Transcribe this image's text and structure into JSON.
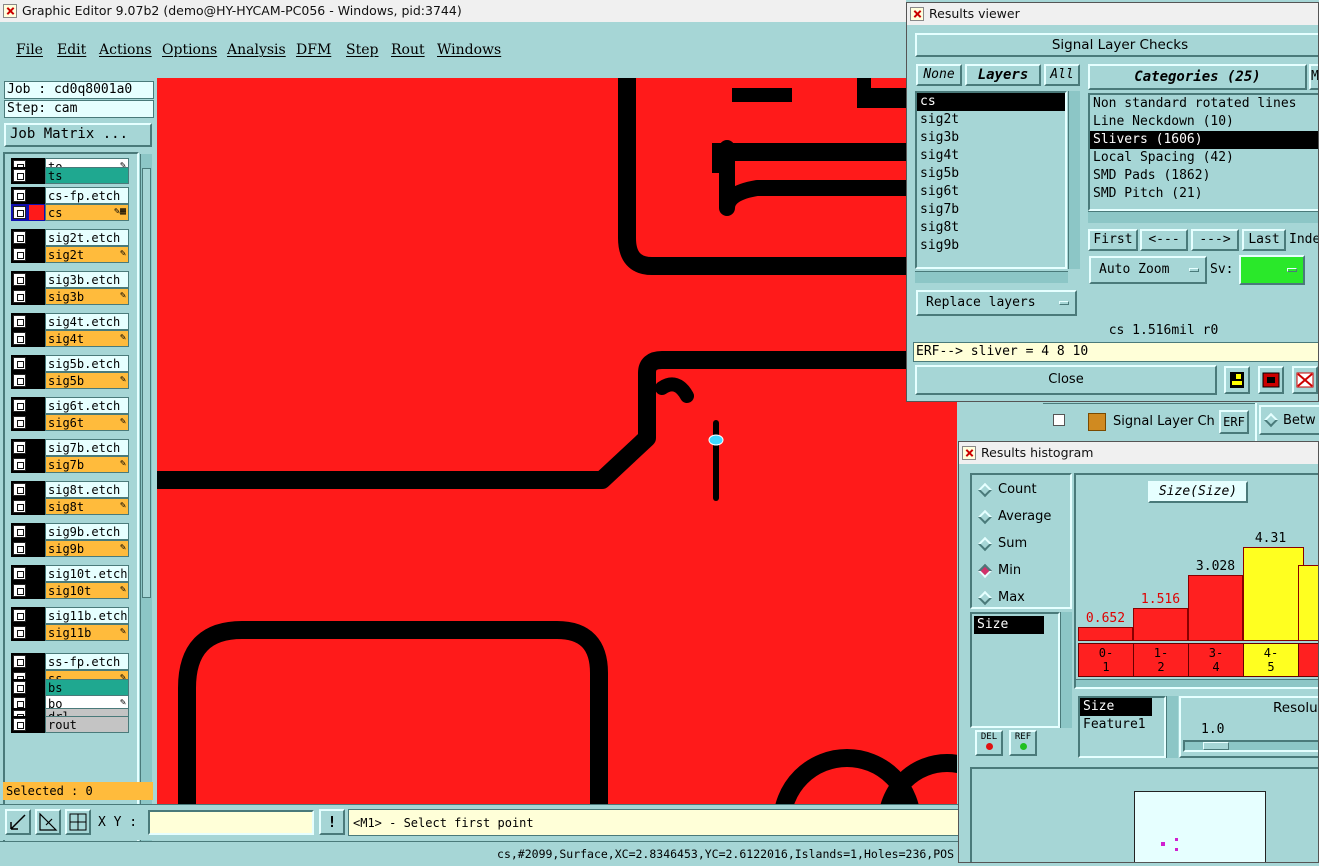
{
  "app": {
    "title": "Graphic Editor 9.07b2 (demo@HY-HYCAM-PC056 - Windows, pid:3744)"
  },
  "menu": [
    "File",
    "Edit",
    "Actions",
    "Options",
    "Analysis",
    "DFM",
    "Step",
    "Rout",
    "Windows"
  ],
  "left_panel": {
    "job": "Job : cd0q8001a0",
    "step": "Step: cam",
    "job_matrix": "Job Matrix ...",
    "selected": "Selected : 0",
    "layers": [
      {
        "name": "to",
        "color": "white",
        "icon": "edit"
      },
      {
        "name": "ts",
        "color": "green",
        "icon": ""
      },
      {
        "name": "cs-fp.etch",
        "color": "light",
        "icon": ""
      },
      {
        "name": "cs",
        "color": "orange",
        "icon": "edit-work",
        "active": true
      },
      {
        "name": "sig2t.etch",
        "color": "light",
        "icon": ""
      },
      {
        "name": "sig2t",
        "color": "orange",
        "icon": "edit"
      },
      {
        "name": "sig3b.etch",
        "color": "light",
        "icon": ""
      },
      {
        "name": "sig3b",
        "color": "orange",
        "icon": "edit"
      },
      {
        "name": "sig4t.etch",
        "color": "light",
        "icon": ""
      },
      {
        "name": "sig4t",
        "color": "orange",
        "icon": "edit"
      },
      {
        "name": "sig5b.etch",
        "color": "light",
        "icon": ""
      },
      {
        "name": "sig5b",
        "color": "orange",
        "icon": "edit"
      },
      {
        "name": "sig6t.etch",
        "color": "light",
        "icon": ""
      },
      {
        "name": "sig6t",
        "color": "orange",
        "icon": "edit"
      },
      {
        "name": "sig7b.etch",
        "color": "light",
        "icon": ""
      },
      {
        "name": "sig7b",
        "color": "orange",
        "icon": "edit"
      },
      {
        "name": "sig8t.etch",
        "color": "light",
        "icon": ""
      },
      {
        "name": "sig8t",
        "color": "orange",
        "icon": "edit"
      },
      {
        "name": "sig9b.etch",
        "color": "light",
        "icon": ""
      },
      {
        "name": "sig9b",
        "color": "orange",
        "icon": "edit"
      },
      {
        "name": "sig10t.etch",
        "color": "light",
        "icon": ""
      },
      {
        "name": "sig10t",
        "color": "orange",
        "icon": "edit"
      },
      {
        "name": "sig11b.etch",
        "color": "light",
        "icon": ""
      },
      {
        "name": "sig11b",
        "color": "orange",
        "icon": "edit"
      },
      {
        "name": "ss-fp.etch",
        "color": "light",
        "icon": ""
      },
      {
        "name": "ss",
        "color": "orange",
        "icon": "edit"
      },
      {
        "name": "bs",
        "color": "green",
        "icon": ""
      },
      {
        "name": "bo",
        "color": "white",
        "icon": "edit"
      },
      {
        "name": "drl",
        "color": "grey",
        "icon": ""
      },
      {
        "name": "rout",
        "color": "grey",
        "icon": ""
      }
    ]
  },
  "bottom_bar": {
    "xy_label": "X Y :",
    "xy_value": "",
    "prompt": "<M1> - Select first point",
    "status": "cs,#2099,Surface,XC=2.8346453,YC=2.6122016,Islands=1,Holes=236,POS"
  },
  "results_viewer": {
    "title": "Results viewer",
    "header": "Signal Layer Checks",
    "none_btn": "None",
    "layers_btn": "Layers",
    "all_btn": "All",
    "layers": [
      "cs",
      "sig2t",
      "sig3b",
      "sig4t",
      "sig5b",
      "sig6t",
      "sig7b",
      "sig8t",
      "sig9b"
    ],
    "categories_btn": "Categories (25)",
    "m_btn": "Mo",
    "categories": [
      "Non standard rotated lines",
      "Line Neckdown (10)",
      "Slivers (1606)",
      "Local Spacing (42)",
      "SMD Pads (1862)",
      "SMD Pitch (21)"
    ],
    "first_btn": "First",
    "prev_btn": "<---",
    "next_btn": "--->",
    "last_btn": "Last",
    "index_label": "Inde",
    "auto_zoom": "Auto Zoom",
    "sv_label": "Sv:",
    "replace_layers": "Replace layers",
    "info_line": "cs 1.516mil  r0",
    "erf_line": "ERF--> sliver = 4 8 10",
    "close_btn": "Close"
  },
  "taskbar_strip": {
    "signal_label": "Signal Layer Ch",
    "erf": "ERF",
    "between": "Betw"
  },
  "histogram": {
    "title": "Results histogram",
    "modes": [
      {
        "label": "Count",
        "on": false
      },
      {
        "label": "Average",
        "on": false
      },
      {
        "label": "Sum",
        "on": false
      },
      {
        "label": "Min",
        "on": true
      },
      {
        "label": "Max",
        "on": false
      }
    ],
    "size_list": [
      "Size"
    ],
    "size_header": "Size(Size)",
    "del_btn": "DEL",
    "ref_btn": "REF",
    "field_list": [
      "Size",
      "Feature1"
    ],
    "resolution_label": "Resolut",
    "resolution_value": "1.0"
  },
  "chart_data": {
    "type": "bar",
    "categories": [
      "0-1",
      "1-2",
      "3-4",
      "4-5"
    ],
    "values": [
      0.652,
      1.516,
      3.028,
      4.31
    ],
    "bar_colors": [
      "#ff2020",
      "#ff2020",
      "#ff2020",
      "#ffff20"
    ],
    "label_colors": [
      "#e00000",
      "#e00000",
      "#000000",
      "#000000"
    ],
    "ylim": [
      0,
      5.2
    ]
  }
}
